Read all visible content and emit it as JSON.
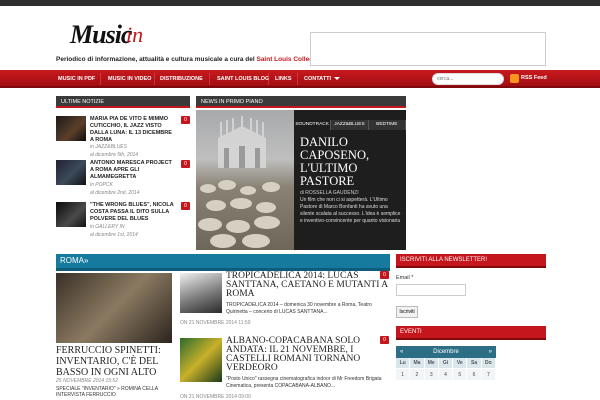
{
  "colors": {
    "accent": "#c4161c",
    "blue": "#157a9e",
    "dark": "#3a3a3a"
  },
  "logo": {
    "word": "Music",
    "suffix": "in",
    "tagline": "Periodico di informazione, attualità e cultura musicale a cura del",
    "tagline_red": "Saint Louis College of Music"
  },
  "nav": {
    "items": [
      "MUSIC IN PDF",
      "MUSIC IN VIDEO",
      "DISTRIBUZIONE",
      "SAINT LOUIS BLOG",
      "LINKS",
      "CONTATTI"
    ],
    "search_placeholder": "cerca...",
    "rss": "RSS Feed"
  },
  "latest": {
    "heading": "ULTIME NOTIZIE",
    "items": [
      {
        "title": "MARIA PIA DE VITO E MIMMO CUTICCHIO, IL JAZZ VISTO DALLA LUNA: IL 13 DICEMBRE A ROMA",
        "category_prefix": "in",
        "category": "JAZZ&BLUES",
        "date": "al dicembre 5th, 2014",
        "comments": "0"
      },
      {
        "title": "ANTONIO MARESCA PROJECT A ROMA APRE GLI ALMAMEGRETTA",
        "category_prefix": "in",
        "category": "POPCK",
        "date": "al dicembre 2nd, 2014",
        "comments": "0"
      },
      {
        "title": "\"THE WRONG BLUES\", NICOLA COSTA PASSA IL DITO SULLA POLVERE DEL BLUES",
        "category_prefix": "in",
        "category": "GALLERY IN",
        "date": "al dicembre 1st, 2014",
        "comments": "0"
      }
    ]
  },
  "featured": {
    "heading": "NEWS IN PRIMO PIANO",
    "tabs": [
      "SOUNDTRACK",
      "JAZZ&BLUES",
      "BEDTIME"
    ],
    "title": "DANILO CAPOSENO, L'ULTIMO PASTORE",
    "author": "di ROSSELLA GAUDENZI",
    "excerpt": "Un film che non ci si aspetterà. L'Ultimo Pastore di Marco Bonfanti ha avuto una silente scalata al successo. L'idea è semplice e inventivo-convincente per quanto visionaria"
  },
  "category": {
    "title": "ROMA»",
    "big": {
      "title": "FERRUCCIO SPINETTI: INVENTARIO, C'È DEL BASSO IN OGNI ALTO",
      "date": "25 NOVEMBRE 2014 15:52",
      "excerpt": "SPECIALE \"INVENTARIO\" » ROMINA CELLA INTERVISTA FERRUCCIO"
    },
    "articles": [
      {
        "title": "TROPICADELICA 2014: LUCAS SANTTANA, CAETANO E MUTANTI A ROMA",
        "excerpt": "TROPICADELICA 2014 – domenica 30 novembre a Roma, Teatro Quirinetta – concerto di LUCAS SANTTANA...",
        "date": "ON 21 NOVEMBRE 2014 11:59",
        "comments": "0"
      },
      {
        "title": "ALBANO-COPACABANA SOLO ANDATA: IL 21 NOVEMBRE, I CASTELLI ROMANI TORNANO VERDEORO",
        "excerpt": "\"Posto Unico\" rassegna cinematografica indoor di Mr Freedom Brigata Cinematica, presenta COPACABANA-ALBANO...",
        "date": "ON 21 NOVEMBRE 2014 09:00",
        "comments": "0"
      }
    ]
  },
  "newsletter": {
    "heading": "ISCRIVITI ALLA NEWSLETTER!",
    "email_label": "Email *",
    "button": "Iscriviti"
  },
  "events": {
    "heading": "EVENTI",
    "month": "Dicembre",
    "prev": "«",
    "next": "»",
    "days": [
      "Lu",
      "Ma",
      "Me",
      "Gi",
      "Ve",
      "Sa",
      "Do"
    ],
    "week1": [
      "1",
      "2",
      "3",
      "4",
      "5",
      "6",
      "7"
    ]
  }
}
